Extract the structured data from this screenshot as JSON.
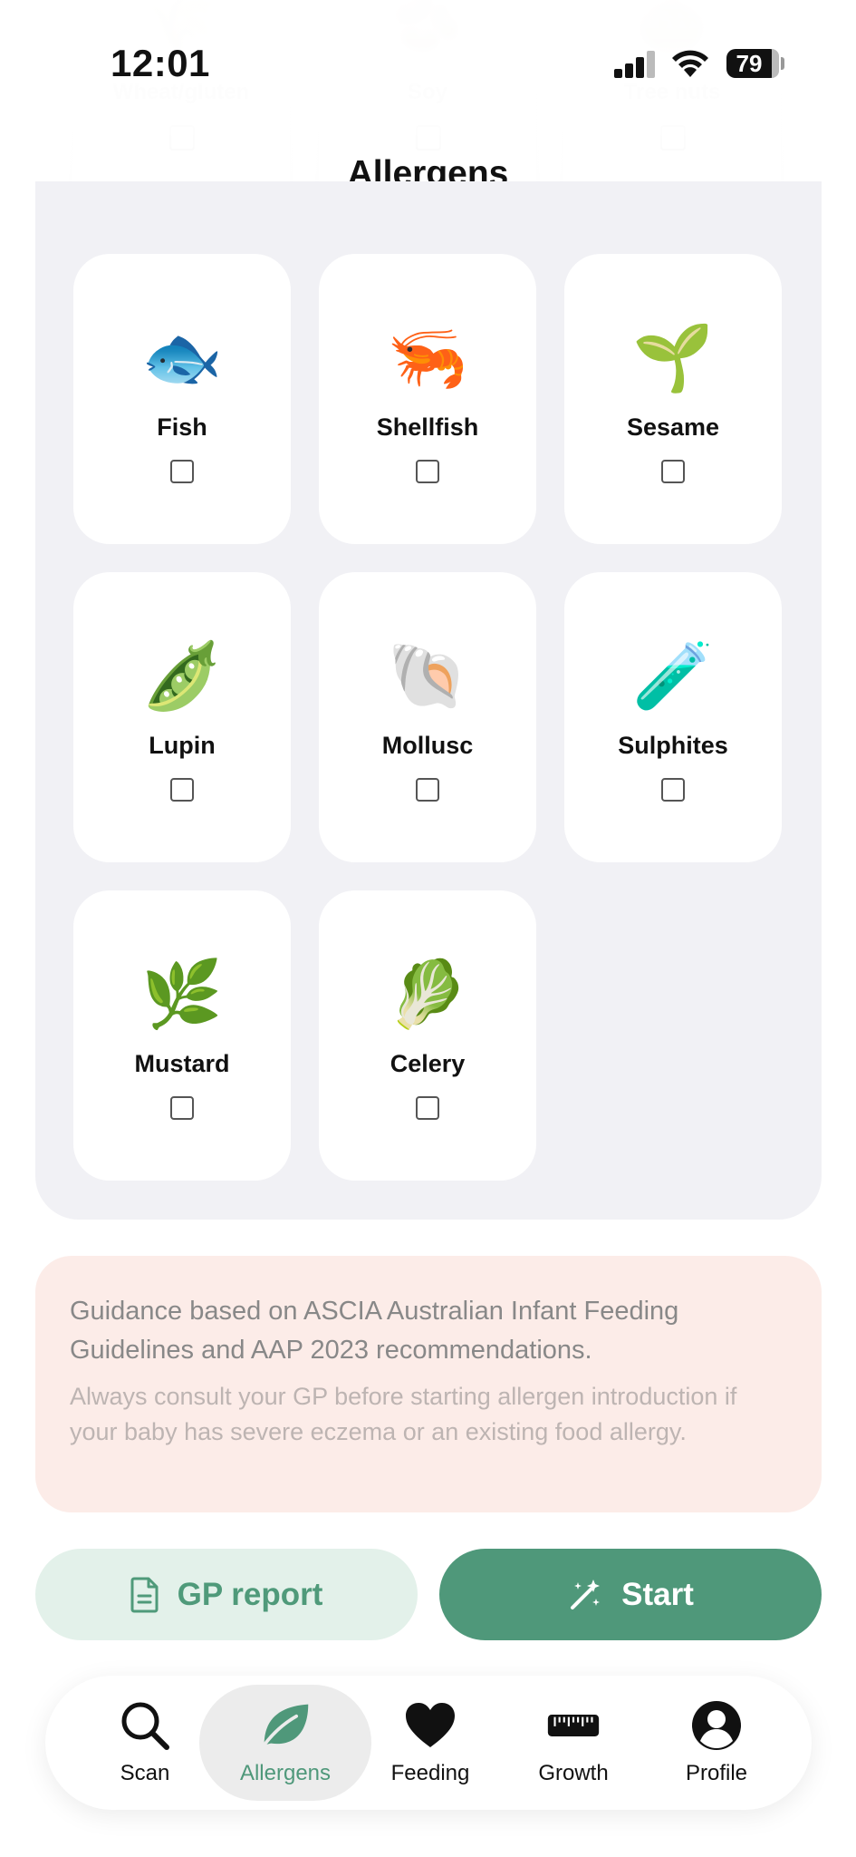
{
  "status_bar": {
    "time": "12:01",
    "battery": "79"
  },
  "page": {
    "title": "Allergens"
  },
  "ghost_row": [
    {
      "label": "Wheat/gluten"
    },
    {
      "label": "Soy"
    },
    {
      "label": "Tree nuts"
    }
  ],
  "allergens": [
    {
      "emoji": "🐟",
      "label": "Fish",
      "checked": false
    },
    {
      "emoji": "🦐",
      "label": "Shellfish",
      "checked": false
    },
    {
      "emoji": "🌱",
      "label": "Sesame",
      "checked": false
    },
    {
      "emoji": "🫛",
      "label": "Lupin",
      "checked": false
    },
    {
      "emoji": "🐚",
      "label": "Mollusc",
      "checked": false
    },
    {
      "emoji": "🧪",
      "label": "Sulphites",
      "checked": false
    },
    {
      "emoji": "🌿",
      "label": "Mustard",
      "checked": false
    },
    {
      "emoji": "🥬",
      "label": "Celery",
      "checked": false
    }
  ],
  "guidance": {
    "primary": "Guidance based on ASCIA Australian Infant Feeding Guidelines and AAP 2023 recommendations.",
    "secondary": "Always consult your GP before starting allergen introduction if your baby has severe eczema or an existing food allergy."
  },
  "actions": {
    "gp_report": "GP report",
    "start": "Start"
  },
  "tabs": [
    {
      "label": "Scan",
      "icon": "search-icon",
      "active": false
    },
    {
      "label": "Allergens",
      "icon": "leaf-icon",
      "active": true
    },
    {
      "label": "Feeding",
      "icon": "heart-icon",
      "active": false
    },
    {
      "label": "Growth",
      "icon": "ruler-icon",
      "active": false
    },
    {
      "label": "Profile",
      "icon": "person-circle-icon",
      "active": false
    }
  ],
  "colors": {
    "accent": "#4f987a",
    "accent_light": "#e3f1ea",
    "panel_bg": "#f1f1f5",
    "note_bg": "#fcece8"
  }
}
